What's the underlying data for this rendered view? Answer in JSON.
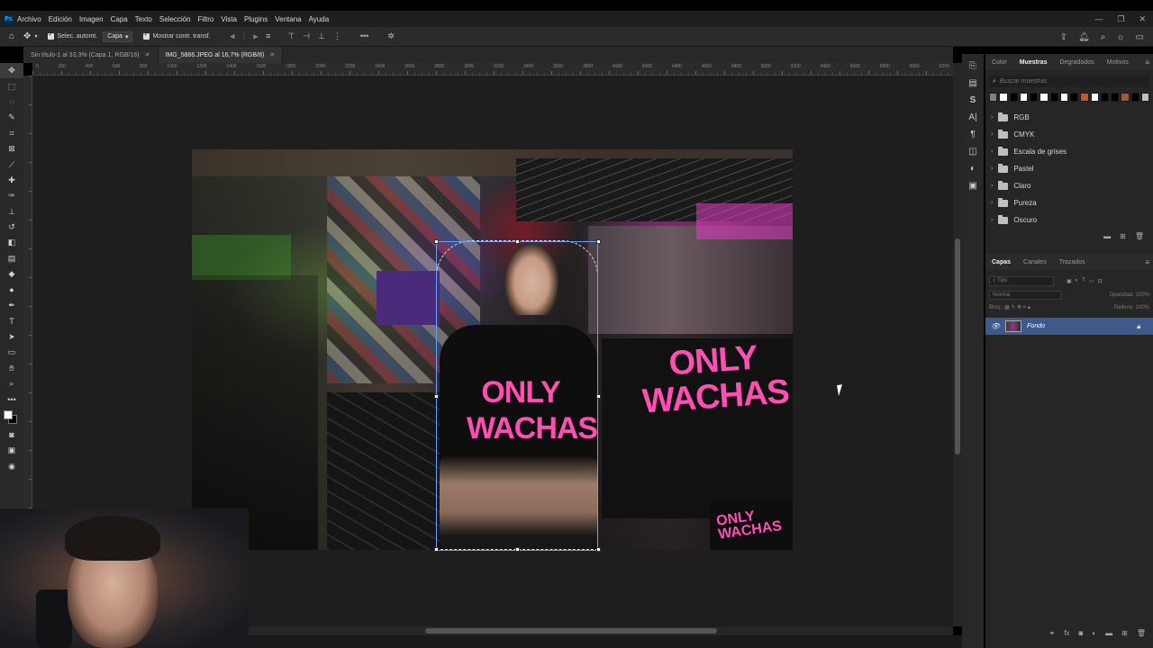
{
  "app": {
    "logo_text": "Ps",
    "menu": [
      "Archivo",
      "Edición",
      "Imagen",
      "Capa",
      "Texto",
      "Selección",
      "Filtro",
      "Vista",
      "Plugins",
      "Ventana",
      "Ayuda"
    ],
    "window_controls": [
      "—",
      "❐",
      "✕"
    ]
  },
  "options": {
    "auto_select_label": "Selec. automt.",
    "auto_select_target": "Capa",
    "show_transform_label": "Mostrar contr. transf."
  },
  "tabs": [
    {
      "label": "Sin título-1 al 33,3% (Capa 1, RGB/16)",
      "close": "✕"
    },
    {
      "label": "IMG_5866.JPEG al 16,7% (RGB/8)",
      "close": "✕"
    }
  ],
  "ruler_labels": [
    "0",
    "200",
    "400",
    "600",
    "800",
    "1000",
    "1200",
    "1400",
    "1600",
    "1800",
    "2000",
    "2200",
    "2400",
    "2600",
    "2800",
    "3000",
    "3200",
    "3400",
    "3600",
    "3800",
    "4000",
    "4200",
    "4400",
    "4600",
    "4800",
    "5000",
    "5200",
    "5400",
    "5600",
    "5800",
    "6000",
    "6200"
  ],
  "photo": {
    "shirt_text": "ONLY WACHAS",
    "person_shirt_text": "ONLY WACHAS",
    "corner_text": "ONLY WACHAS"
  },
  "swatches_panel": {
    "tabs": [
      "Color",
      "Muestras",
      "Degradados",
      "Motivos"
    ],
    "active_tab": "Muestras",
    "search_placeholder": "Buscar muestras",
    "swatch_colors": [
      "#808080",
      "#ffffff",
      "#000000",
      "#ffffff",
      "#000000",
      "#ffffff",
      "#000000",
      "#ffffff",
      "#000000",
      "#b5602a",
      "#ffffff",
      "#000000",
      "#000000",
      "#a05a3a",
      "#000000",
      "#c0c0c0",
      "#ffffff",
      "#000000"
    ],
    "groups": [
      "RGB",
      "CMYK",
      "Escala de grises",
      "Pastel",
      "Claro",
      "Pureza",
      "Oscuro"
    ]
  },
  "layers_panel": {
    "tabs": [
      "Capas",
      "Canales",
      "Trazados"
    ],
    "active_tab": "Capas",
    "filter_placeholder": "Tipo",
    "blend_mode": "Normal",
    "opacity_label": "Opacidad:",
    "opacity_value": "100%",
    "lock_label": "Bloq.:",
    "fill_label": "Relleno:",
    "fill_value": "100%",
    "layers": [
      {
        "name": "Fondo",
        "visible": true,
        "locked": true
      }
    ]
  },
  "colors": {
    "accent": "#31a8ff",
    "selected_layer": "#3d5a8a",
    "shirt_pink": "#ff4fb3"
  }
}
